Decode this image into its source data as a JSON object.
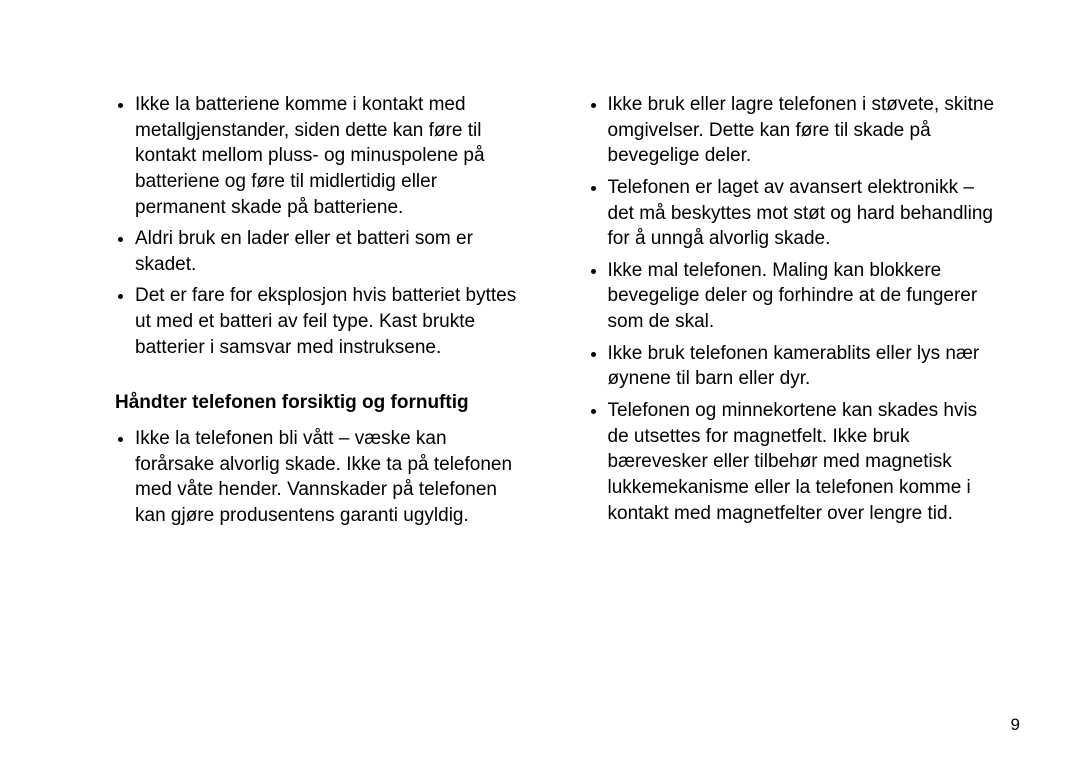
{
  "left": {
    "list1": [
      "Ikke la batteriene komme i kontakt med metallgjenstander, siden dette kan føre til kontakt mellom pluss- og minuspolene på batteriene og føre til midlertidig eller permanent skade på batteriene.",
      "Aldri bruk en lader eller et batteri som er skadet.",
      "Det er fare for eksplosjon hvis batteriet byttes ut med et batteri av feil type. Kast brukte batterier i samsvar med instruksene."
    ],
    "heading": "Håndter telefonen forsiktig og fornuftig",
    "list2": [
      "Ikke la telefonen bli vått – væske kan forårsake alvorlig skade. Ikke ta på telefonen med våte hender. Vannskader på telefonen kan gjøre produsentens garanti ugyldig."
    ]
  },
  "right": {
    "list1": [
      "Ikke bruk eller lagre telefonen i støvete, skitne omgivelser. Dette kan føre til skade på bevegelige deler.",
      "Telefonen er laget av avansert elektronikk – det må beskyttes mot støt og hard behandling for å unngå alvorlig skade.",
      "Ikke mal telefonen. Maling kan blokkere bevegelige deler og forhindre at de fungerer som de skal.",
      "Ikke bruk telefonen kamerablits eller lys nær øynene til barn eller dyr.",
      "Telefonen og minnekortene kan skades hvis de utsettes for magnetfelt. Ikke bruk bærevesker eller tilbehør med magnetisk lukkemekanisme eller la telefonen komme i kontakt med magnetfelter over lengre tid."
    ]
  },
  "pageNumber": "9"
}
